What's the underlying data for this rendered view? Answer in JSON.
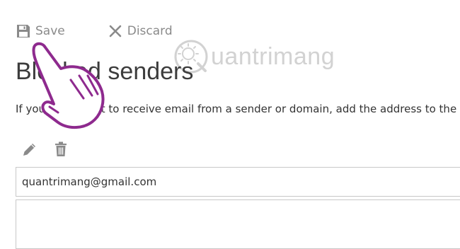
{
  "toolbar": {
    "save_label": "Save",
    "discard_label": "Discard",
    "save_icon": "floppy-disk-icon",
    "discard_icon": "x-icon"
  },
  "watermark": {
    "text": "uantrimang"
  },
  "page": {
    "title": "Blocked senders",
    "description": "If you don't want to receive email from a sender or domain, add the address to the b"
  },
  "actions": {
    "edit_icon": "pencil-icon",
    "delete_icon": "trash-icon"
  },
  "input": {
    "value": "quantrimang@gmail.com"
  },
  "colors": {
    "toolbar_text": "#8a8a8a",
    "icon_gray": "#8a8a8a",
    "border": "#c8c8c8",
    "hand_cursor": "#8e2a8e",
    "watermark": "#d2d2d2"
  }
}
